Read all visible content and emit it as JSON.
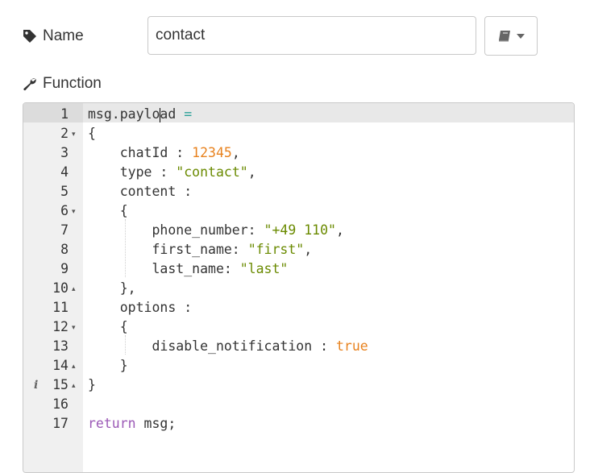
{
  "name_field": {
    "label": "Name",
    "value": "contact",
    "icon": "tag-icon"
  },
  "library_button": {
    "icon": "book-icon",
    "caret": "caret-down-icon"
  },
  "function_section": {
    "label": "Function",
    "icon": "wrench-icon"
  },
  "editor": {
    "active_line": 1,
    "info_line": 15,
    "lines": [
      {
        "n": "1",
        "fold": "",
        "tokens": [
          [
            "plain",
            "msg.paylo"
          ],
          [
            "cursor",
            ""
          ],
          [
            "plain",
            "ad "
          ],
          [
            "op",
            "="
          ]
        ]
      },
      {
        "n": "2",
        "fold": "down",
        "tokens": [
          [
            "plain",
            "{"
          ]
        ]
      },
      {
        "n": "3",
        "fold": "",
        "tokens": [
          [
            "plain",
            "    chatId : "
          ],
          [
            "num",
            "12345"
          ],
          [
            "plain",
            ","
          ]
        ]
      },
      {
        "n": "4",
        "fold": "",
        "tokens": [
          [
            "plain",
            "    type : "
          ],
          [
            "str",
            "\"contact\""
          ],
          [
            "plain",
            ","
          ]
        ]
      },
      {
        "n": "5",
        "fold": "",
        "tokens": [
          [
            "plain",
            "    content :"
          ]
        ]
      },
      {
        "n": "6",
        "fold": "down",
        "tokens": [
          [
            "plain",
            "    {"
          ]
        ]
      },
      {
        "n": "7",
        "fold": "",
        "tokens": [
          [
            "plain",
            "        phone_number: "
          ],
          [
            "str",
            "\"+49 110\""
          ],
          [
            "plain",
            ","
          ]
        ]
      },
      {
        "n": "8",
        "fold": "",
        "tokens": [
          [
            "plain",
            "        first_name: "
          ],
          [
            "str",
            "\"first\""
          ],
          [
            "plain",
            ","
          ]
        ]
      },
      {
        "n": "9",
        "fold": "",
        "tokens": [
          [
            "plain",
            "        last_name: "
          ],
          [
            "str",
            "\"last\""
          ]
        ]
      },
      {
        "n": "10",
        "fold": "up",
        "tokens": [
          [
            "plain",
            "    },"
          ]
        ]
      },
      {
        "n": "11",
        "fold": "",
        "tokens": [
          [
            "plain",
            "    options :"
          ]
        ]
      },
      {
        "n": "12",
        "fold": "down",
        "tokens": [
          [
            "plain",
            "    {"
          ]
        ]
      },
      {
        "n": "13",
        "fold": "",
        "tokens": [
          [
            "plain",
            "        disable_notification : "
          ],
          [
            "bool",
            "true"
          ]
        ]
      },
      {
        "n": "14",
        "fold": "up",
        "tokens": [
          [
            "plain",
            "    }"
          ]
        ]
      },
      {
        "n": "15",
        "fold": "up",
        "tokens": [
          [
            "plain",
            "}"
          ]
        ]
      },
      {
        "n": "16",
        "fold": "",
        "tokens": []
      },
      {
        "n": "17",
        "fold": "",
        "tokens": [
          [
            "kw",
            "return"
          ],
          [
            "plain",
            " msg;"
          ]
        ]
      }
    ]
  }
}
